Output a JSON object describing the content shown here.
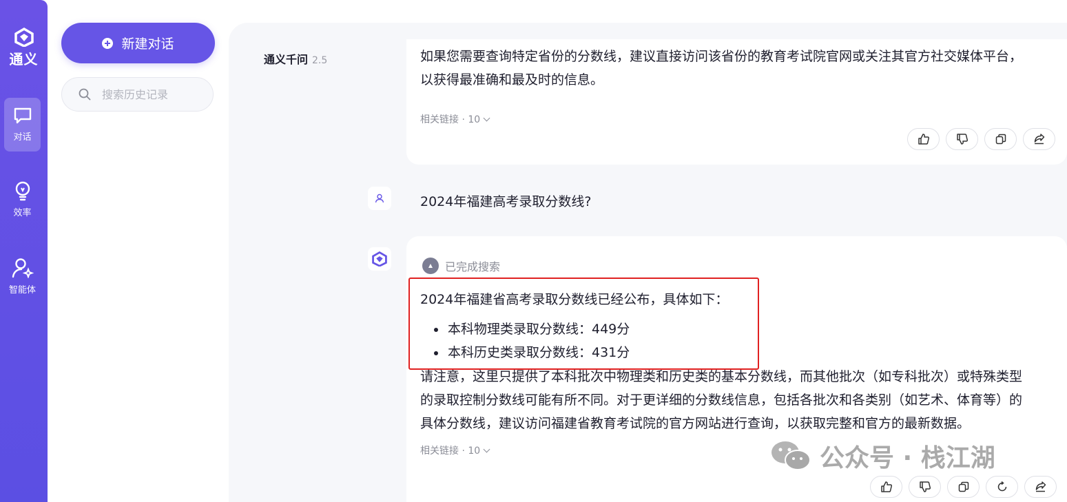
{
  "app": {
    "logo_text": "通义"
  },
  "rail": {
    "items": [
      {
        "label": "对话",
        "icon": "chat-bubble-icon",
        "active": true
      },
      {
        "label": "效率",
        "icon": "lightbulb-icon",
        "active": false
      },
      {
        "label": "智能体",
        "icon": "agent-person-icon",
        "active": false
      }
    ]
  },
  "side": {
    "new_chat_label": "新建对话",
    "search_placeholder": "搜索历史记录"
  },
  "chat": {
    "model_name": "通义千问",
    "model_version": "2.5",
    "prev_answer": {
      "line1": "如果您需要查询特定省份的分数线，建议直接访问该省份的教育考试院官网或关注其官方社交媒体平台，",
      "line2": "以获得最准确和最及时的信息。",
      "related_links": "相关链接 · 10"
    },
    "user_question": "2024年福建高考录取分数线?",
    "answer": {
      "status": "已完成搜索",
      "heading": "2024年福建省高考录取分数线已经公布，具体如下：",
      "bullets": [
        "本科物理类录取分数线：449分",
        "本科历史类录取分数线：431分"
      ],
      "note_line1": "请注意，这里只提供了本科批次中物理类和历史类的基本分数线，而其他批次（如专科批次）或特殊类型",
      "note_line2": "的录取控制分数线可能有所不同。对于更详细的分数线信息，包括各批次和各类别（如艺术、体育等）的",
      "note_line3": "具体分数线，建议访问福建省教育考试院的官方网站进行查询，以获取完整和官方的最新数据。",
      "related_links": "相关链接 · 10"
    }
  },
  "watermark": "公众号 · 栈江湖",
  "colors": {
    "accent": "#6655e6",
    "highlight_border": "#e02020",
    "main_bg": "#f6f7fa"
  }
}
